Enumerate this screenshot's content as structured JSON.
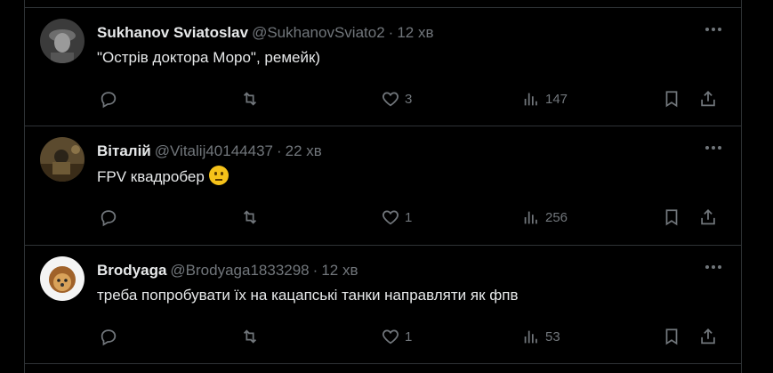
{
  "tweets": [
    {
      "name": "Sukhanov Sviatoslav",
      "handle": "@SukhanovSviato2",
      "separator": "·",
      "time": "12 хв",
      "text": "\"Острів доктора Моро\", ремейк)",
      "emoji": "",
      "likes": "3",
      "views": "147",
      "avatar_color": "#3a3a3a"
    },
    {
      "name": "Віталій",
      "handle": "@Vitalij40144437",
      "separator": "·",
      "time": "22 хв",
      "text": "FPV квадробер",
      "emoji": "neutral-face",
      "likes": "1",
      "views": "256",
      "avatar_color": "#4a3a22"
    },
    {
      "name": "Brodyaga",
      "handle": "@Brodyaga1833298",
      "separator": "·",
      "time": "12 хв",
      "text": "треба попробувати їх на кацапські танки направляти як фпв",
      "emoji": "",
      "likes": "1",
      "views": "53",
      "avatar_color": "#f2f2f2"
    }
  ],
  "colors": {
    "background": "#000000",
    "text": "#e7e9ea",
    "muted": "#71767b",
    "border": "#2f3336"
  }
}
